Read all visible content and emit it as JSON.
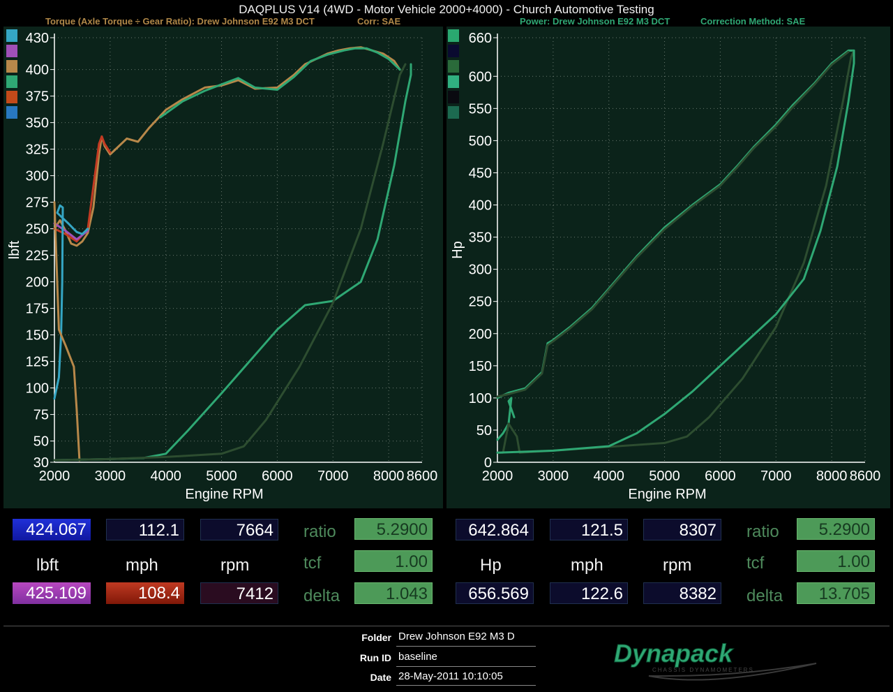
{
  "header": {
    "title": "DAQPLUS V14 (4WD - Motor Vehicle 2000+4000) - Church Automotive Testing",
    "torque_title": "Torque (Axle Torque ÷ Gear Ratio): Drew Johnson E92 M3 DCT",
    "torque_corr": "Corr: SAE",
    "power_title": "Power: Drew Johnson E92 M3 DCT",
    "power_corr": "Correction Method: SAE"
  },
  "colors": {
    "panel_bg": "#0b231a",
    "grid": "#6b7a70",
    "series_green": "#2fa874",
    "series_orange": "#b8884a",
    "series_red": "#c23a22",
    "series_magenta": "#b040b8",
    "series_blue": "#3aa0d8",
    "series_dark": "#2d4d30"
  },
  "chart_data": [
    {
      "type": "line",
      "ylabel": "lbft",
      "xlabel": "Engine RPM",
      "xlim": [
        2000,
        8600
      ],
      "ylim": [
        30,
        430
      ],
      "x_ticks": [
        "2000",
        "3000",
        "4000",
        "5000",
        "6000",
        "7000",
        "8000",
        "8600"
      ],
      "y_ticks": [
        "30",
        "50",
        "75",
        "100",
        "125",
        "150",
        "175",
        "200",
        "225",
        "250",
        "275",
        "300",
        "325",
        "350",
        "375",
        "400",
        "430"
      ],
      "legend_colors": [
        "#35a6c4",
        "#a050b8",
        "#b8884a",
        "#2fa874",
        "#c24a1a",
        "#2878c0"
      ],
      "series": [
        {
          "color": "#b8884a",
          "points": [
            [
              2000,
              250
            ],
            [
              2100,
              258
            ],
            [
              2200,
              248
            ],
            [
              2300,
              236
            ],
            [
              2400,
              234
            ],
            [
              2500,
              238
            ],
            [
              2600,
              246
            ],
            [
              2700,
              270
            ],
            [
              2800,
              320
            ],
            [
              2850,
              337
            ],
            [
              2900,
              328
            ],
            [
              3000,
              320
            ],
            [
              3100,
              325
            ],
            [
              3300,
              335
            ],
            [
              3500,
              332
            ],
            [
              3700,
              345
            ],
            [
              4000,
              362
            ],
            [
              4300,
              372
            ],
            [
              4700,
              383
            ],
            [
              5000,
              385
            ],
            [
              5300,
              390
            ],
            [
              5600,
              382
            ],
            [
              6000,
              383
            ],
            [
              6300,
              395
            ],
            [
              6500,
              405
            ],
            [
              6700,
              410
            ],
            [
              6900,
              415
            ],
            [
              7100,
              418
            ],
            [
              7300,
              420
            ],
            [
              7500,
              421
            ],
            [
              7700,
              418
            ],
            [
              7900,
              415
            ],
            [
              8100,
              408
            ],
            [
              8200,
              400
            ]
          ]
        },
        {
          "color": "#c23a22",
          "points": [
            [
              2000,
              250
            ],
            [
              2200,
              245
            ],
            [
              2400,
              238
            ],
            [
              2600,
              250
            ],
            [
              2700,
              290
            ],
            [
              2800,
              330
            ],
            [
              2850,
              337
            ],
            [
              2900,
              330
            ],
            [
              3000,
              322
            ]
          ]
        },
        {
          "color": "#a050b8",
          "points": [
            [
              2000,
              255
            ],
            [
              2200,
              248
            ],
            [
              2400,
              240
            ],
            [
              2600,
              248
            ]
          ]
        },
        {
          "color": "#35a6c4",
          "points": [
            [
              2000,
              90
            ],
            [
              2080,
              110
            ],
            [
              2120,
              150
            ],
            [
              2140,
              200
            ],
            [
              2150,
              270
            ],
            [
              2100,
              272
            ],
            [
              2050,
              265
            ],
            [
              2150,
              260
            ],
            [
              2250,
              255
            ],
            [
              2400,
              247
            ],
            [
              2500,
              245
            ],
            [
              2600,
              250
            ]
          ]
        },
        {
          "color": "#b8884a",
          "points": [
            [
              2000,
              275
            ],
            [
              2050,
              200
            ],
            [
              2080,
              155
            ],
            [
              2200,
              140
            ],
            [
              2350,
              120
            ],
            [
              2400,
              80
            ],
            [
              2450,
              32
            ]
          ]
        },
        {
          "color": "#2fa874",
          "points": [
            [
              2000,
              32
            ],
            [
              3000,
              33
            ],
            [
              3600,
              34
            ],
            [
              4000,
              38
            ],
            [
              4400,
              60
            ],
            [
              5000,
              95
            ],
            [
              5500,
              125
            ],
            [
              6000,
              155
            ],
            [
              6500,
              178
            ],
            [
              7000,
              182
            ],
            [
              7500,
              200
            ],
            [
              7800,
              240
            ],
            [
              8100,
              310
            ],
            [
              8300,
              370
            ],
            [
              8400,
              395
            ],
            [
              8400,
              405
            ]
          ]
        },
        {
          "color": "#2d4d30",
          "points": [
            [
              2000,
              32
            ],
            [
              3000,
              33
            ],
            [
              4000,
              35
            ],
            [
              5000,
              38
            ],
            [
              5400,
              45
            ],
            [
              5800,
              70
            ],
            [
              6400,
              120
            ],
            [
              7000,
              180
            ],
            [
              7500,
              250
            ],
            [
              7900,
              330
            ],
            [
              8200,
              395
            ],
            [
              8300,
              405
            ]
          ]
        },
        {
          "color": "#2fa874",
          "points": [
            [
              3900,
              355
            ],
            [
              4300,
              370
            ],
            [
              4700,
              380
            ],
            [
              5000,
              386
            ],
            [
              5300,
              392
            ],
            [
              5600,
              383
            ],
            [
              6000,
              381
            ],
            [
              6300,
              393
            ],
            [
              6600,
              408
            ],
            [
              6900,
              414
            ],
            [
              7200,
              418
            ],
            [
              7400,
              420
            ],
            [
              7600,
              420
            ],
            [
              7800,
              416
            ],
            [
              8000,
              410
            ],
            [
              8200,
              400
            ]
          ]
        }
      ]
    },
    {
      "type": "line",
      "ylabel": "Hp",
      "xlabel": "Engine RPM",
      "xlim": [
        2000,
        8600
      ],
      "ylim": [
        0,
        660
      ],
      "x_ticks": [
        "2000",
        "3000",
        "4000",
        "5000",
        "6000",
        "7000",
        "8000",
        "8600"
      ],
      "y_ticks": [
        "0",
        "50",
        "100",
        "150",
        "200",
        "250",
        "300",
        "350",
        "400",
        "450",
        "500",
        "550",
        "600",
        "660"
      ],
      "legend_colors": [
        "#2aa870",
        "#0a0a30",
        "#2a6a3a",
        "#30b080",
        "#0a0a10",
        "#1c6a50"
      ],
      "series": [
        {
          "color": "#2fa874",
          "points": [
            [
              2000,
              100
            ],
            [
              2200,
              108
            ],
            [
              2500,
              115
            ],
            [
              2800,
              140
            ],
            [
              2900,
              185
            ],
            [
              3000,
              190
            ],
            [
              3300,
              210
            ],
            [
              3700,
              240
            ],
            [
              4000,
              270
            ],
            [
              4500,
              320
            ],
            [
              5000,
              365
            ],
            [
              5500,
              400
            ],
            [
              6000,
              432
            ],
            [
              6300,
              460
            ],
            [
              6600,
              490
            ],
            [
              7000,
              525
            ],
            [
              7300,
              555
            ],
            [
              7700,
              590
            ],
            [
              8000,
              620
            ],
            [
              8300,
              640
            ],
            [
              8400,
              640
            ]
          ]
        },
        {
          "color": "#2d4d30",
          "points": [
            [
              2000,
              102
            ],
            [
              2200,
              106
            ],
            [
              2500,
              113
            ],
            [
              2800,
              138
            ],
            [
              2900,
              182
            ],
            [
              3000,
              188
            ],
            [
              3300,
              208
            ],
            [
              3700,
              238
            ],
            [
              4000,
              268
            ],
            [
              4500,
              318
            ],
            [
              5000,
              362
            ],
            [
              5500,
              398
            ],
            [
              6000,
              430
            ],
            [
              6300,
              458
            ],
            [
              6600,
              488
            ],
            [
              7000,
              522
            ],
            [
              7300,
              552
            ],
            [
              7700,
              588
            ],
            [
              8000,
              618
            ],
            [
              8300,
              638
            ]
          ]
        },
        {
          "color": "#2fa874",
          "points": [
            [
              2000,
              35
            ],
            [
              2100,
              45
            ],
            [
              2200,
              60
            ],
            [
              2250,
              100
            ],
            [
              2200,
              95
            ],
            [
              2300,
              70
            ]
          ]
        },
        {
          "color": "#2d4d30",
          "points": [
            [
              2000,
              15
            ],
            [
              2100,
              15
            ],
            [
              2200,
              60
            ],
            [
              2350,
              40
            ],
            [
              2400,
              15
            ],
            [
              3000,
              18
            ],
            [
              4000,
              24
            ],
            [
              5000,
              30
            ],
            [
              5400,
              40
            ],
            [
              5800,
              70
            ],
            [
              6400,
              130
            ],
            [
              7000,
              210
            ],
            [
              7500,
              310
            ],
            [
              7900,
              430
            ],
            [
              8200,
              560
            ],
            [
              8350,
              630
            ],
            [
              8400,
              640
            ]
          ]
        },
        {
          "color": "#2fa874",
          "points": [
            [
              2000,
              15
            ],
            [
              3000,
              18
            ],
            [
              4000,
              25
            ],
            [
              4500,
              45
            ],
            [
              5000,
              75
            ],
            [
              5500,
              110
            ],
            [
              6000,
              150
            ],
            [
              6500,
              190
            ],
            [
              7000,
              230
            ],
            [
              7500,
              285
            ],
            [
              7800,
              360
            ],
            [
              8100,
              460
            ],
            [
              8300,
              560
            ],
            [
              8400,
              620
            ],
            [
              8400,
              640
            ]
          ]
        }
      ]
    }
  ],
  "readouts": {
    "left": {
      "r1": [
        "424.067",
        "112.1",
        "7664"
      ],
      "units": [
        "lbft",
        "mph",
        "rpm"
      ],
      "r2": [
        "425.109",
        "108.4",
        "7412"
      ],
      "ratio_label": "ratio",
      "ratio": "5.2900",
      "tcf_label": "tcf",
      "tcf": "1.00",
      "delta_label": "delta",
      "delta": "1.043"
    },
    "right": {
      "r1": [
        "642.864",
        "121.5",
        "8307"
      ],
      "units": [
        "Hp",
        "mph",
        "rpm"
      ],
      "r2": [
        "656.569",
        "122.6",
        "8382"
      ],
      "ratio_label": "ratio",
      "ratio": "5.2900",
      "tcf_label": "tcf",
      "tcf": "1.00",
      "delta_label": "delta",
      "delta": "13.705"
    }
  },
  "info": {
    "folder_label": "Folder",
    "folder": "Drew Johnson E92 M3 D",
    "runid_label": "Run ID",
    "runid": "baseline",
    "date_label": "Date",
    "date": "28-May-2011 10:10:05"
  },
  "logo": {
    "name": "Dynapack",
    "tagline": "CHASSIS DYNAMOMETERS"
  }
}
